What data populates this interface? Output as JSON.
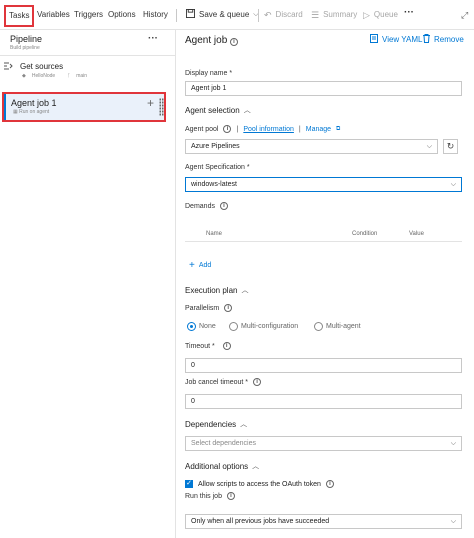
{
  "tabs": [
    "Tasks",
    "Variables",
    "Triggers",
    "Options",
    "History"
  ],
  "toolbar": {
    "save_queue": "Save & queue",
    "discard": "Discard",
    "summary": "Summary",
    "queue": "Queue",
    "more": "···"
  },
  "left": {
    "pipeline_title": "Pipeline",
    "pipeline_sub": "Build pipeline",
    "pipeline_more": "···",
    "get_sources": "Get sources",
    "get_sources_repo": "HelloNode",
    "get_sources_branch": "main",
    "job_title": "Agent job 1",
    "job_sub": "Run on agent"
  },
  "right": {
    "title": "Agent job",
    "view_yaml": "View YAML",
    "remove": "Remove",
    "display_name_label": "Display name *",
    "display_name_value": "Agent job 1",
    "agent_selection": "Agent selection",
    "agent_pool_label": "Agent pool",
    "pool_information": "Pool information",
    "manage": "Manage",
    "agent_pool_value": "Azure Pipelines",
    "agent_spec_label": "Agent Specification *",
    "agent_spec_value": "windows-latest",
    "demands_label": "Demands",
    "col_name": "Name",
    "col_condition": "Condition",
    "col_value": "Value",
    "add": "Add",
    "execution_plan": "Execution plan",
    "parallelism_label": "Parallelism",
    "radio_none": "None",
    "radio_multiconfig": "Multi-configuration",
    "radio_multiagent": "Multi-agent",
    "timeout_label": "Timeout *",
    "timeout_value": "0",
    "cancel_timeout_label": "Job cancel timeout *",
    "cancel_timeout_value": "0",
    "dependencies": "Dependencies",
    "dependencies_placeholder": "Select dependencies",
    "additional_options": "Additional options",
    "oauth_label": "Allow scripts to access the OAuth token",
    "run_this_job_label": "Run this job",
    "run_this_job_value": "Only when all previous jobs have succeeded"
  },
  "colors": {
    "accent": "#0078d4",
    "highlight_border": "#e0353b",
    "selected_bg": "#eaf1fa"
  }
}
